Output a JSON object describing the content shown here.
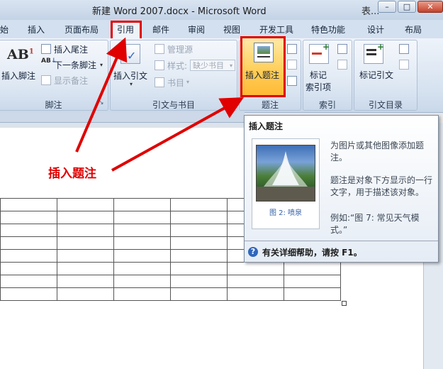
{
  "window": {
    "title": "新建 Word 2007.docx - Microsoft Word",
    "title_extra": "表...",
    "minimize_glyph": "–",
    "maximize_glyph": "□",
    "close_glyph": "✕"
  },
  "tabs": [
    {
      "label": "始"
    },
    {
      "label": "插入"
    },
    {
      "label": "页面布局"
    },
    {
      "label": "引用",
      "highlighted": true
    },
    {
      "label": "邮件"
    },
    {
      "label": "审阅"
    },
    {
      "label": "视图"
    },
    {
      "label": "开发工具"
    },
    {
      "label": "特色功能"
    },
    {
      "label": "设计"
    },
    {
      "label": "布局"
    }
  ],
  "ribbon": {
    "footnotes": {
      "group_label": "脚注",
      "insert_footnote": "插入脚注",
      "insert_endnote": "插入尾注",
      "next_footnote": "下一条脚注",
      "show_notes": "显示备注"
    },
    "citations": {
      "group_label": "引文与书目",
      "insert_citation": "插入引文",
      "manage_sources": "管理源",
      "style_label": "样式:",
      "style_value": "缺少书目",
      "bibliography": "书目"
    },
    "captions": {
      "group_label": "题注",
      "insert_caption": "插入题注"
    },
    "index": {
      "group_label": "索引",
      "mark_entry_line1": "标记",
      "mark_entry_line2": "索引项"
    },
    "toa": {
      "group_label": "引文目录",
      "mark_citation": "标记引文"
    }
  },
  "annotation": {
    "text": "插入题注",
    "color": "#e00000"
  },
  "tooltip": {
    "title": "插入题注",
    "image_caption": "图 2: 喷泉",
    "desc1": "为图片或其他图像添加题注。",
    "desc2": "题注是对象下方显示的一行文字，用于描述该对象。",
    "desc3": "例如:“图 7: 常见天气模式。”",
    "help": "有关详细帮助，请按 F1。",
    "help_icon": "?"
  },
  "colors": {
    "highlight_red": "#e00000",
    "ribbon_blue": "#d6e2f0"
  }
}
